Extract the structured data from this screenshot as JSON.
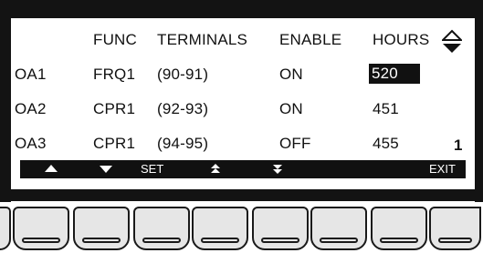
{
  "header": {
    "func": "FUNC",
    "terminals": "TERMINALS",
    "enable": "ENABLE",
    "hours": "HOURS"
  },
  "rows": [
    {
      "output": "OA1",
      "func": "FRQ1",
      "terminals": "(90-91)",
      "enable": "ON",
      "hours": "520",
      "selected": true
    },
    {
      "output": "OA2",
      "func": "CPR1",
      "terminals": "(92-93)",
      "enable": "ON",
      "hours": "451",
      "selected": false
    },
    {
      "output": "OA3",
      "func": "CPR1",
      "terminals": "(94-95)",
      "enable": "OFF",
      "hours": "455",
      "selected": false
    }
  ],
  "page_number": "1",
  "softkeys": {
    "set": "SET",
    "exit": "EXIT",
    "icons": [
      "triangle-up-icon",
      "triangle-down-icon",
      "page-up-icon",
      "page-down-icon",
      "scroll-up-down-icon"
    ]
  },
  "colors": {
    "bezel": "#131313",
    "screen": "#ffffff",
    "highlight": "#111111",
    "key": "#e6e6e6"
  }
}
